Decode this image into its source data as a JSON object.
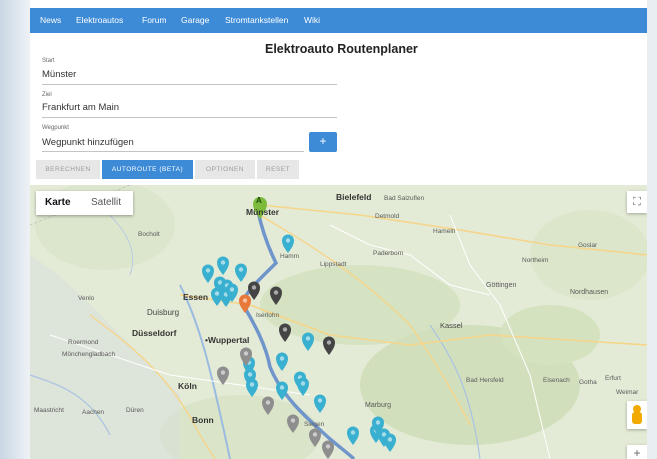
{
  "nav": {
    "items": [
      "News",
      "Elektroautos",
      "Forum",
      "Garage",
      "Stromtankstellen",
      "Wiki"
    ]
  },
  "page": {
    "title": "Elektroauto Routenplaner"
  },
  "form": {
    "start": {
      "label": "Start",
      "value": "Münster"
    },
    "ziel": {
      "label": "Ziel",
      "value": "Frankfurt am Main"
    },
    "wegpunkt": {
      "label": "Wegpunkt",
      "value": "Wegpunkt hinzufügen"
    },
    "add_label": "+"
  },
  "actions": {
    "berechnen": "BERECHNEN",
    "autoroute": "AUTOROUTE (BETA)",
    "optionen": "OPTIONEN",
    "reset": "RESET"
  },
  "map": {
    "type_control": {
      "karte": "Karte",
      "satellit": "Satellit"
    },
    "fullscreen_icon": "fullscreen-icon",
    "zoom_in": "+",
    "start_marker_letter": "A",
    "colors": {
      "route": "#5b86c9",
      "marker_teal": "#3ab0d0",
      "marker_dark": "#444444",
      "marker_grey": "#8e8e8e",
      "marker_orange": "#e8793a",
      "marker_start": "#7dbb3c"
    },
    "labels": {
      "muenster": "Münster",
      "bielefeld": "Bielefeld",
      "bad_salzuflen": "Bad Salzuflen",
      "detmold": "Detmold",
      "hamm": "Hamm",
      "lippstadt": "Lippstadt",
      "paderborn": "Paderborn",
      "bocholt": "Bocholt",
      "essen": "Essen",
      "duisburg": "Duisburg",
      "duesseldorf": "Düsseldorf",
      "wuppertal": "•Wuppertal",
      "moenchengladbach": "Mönchengladbach",
      "koeln": "Köln",
      "bonn": "Bonn",
      "iserlohn": "Iserlohn",
      "kassel": "Kassel",
      "marburg": "Marburg",
      "goettingen": "Göttingen",
      "nordhausen": "Nordhausen",
      "eisenach": "Eisenach",
      "gotha": "Gotha",
      "erfurt": "Erfurt",
      "weimar": "Weimar",
      "maastricht": "Maastricht",
      "aachen": "Aachen",
      "dueren": "Düren",
      "hameln": "Hameln",
      "goslar": "Goslar",
      "northeim": "Northeim",
      "roermond": "Roermond",
      "venlo": "Venlo",
      "bad_hersfeld": "Bad Hersfeld",
      "siegen": "Siegen"
    }
  }
}
